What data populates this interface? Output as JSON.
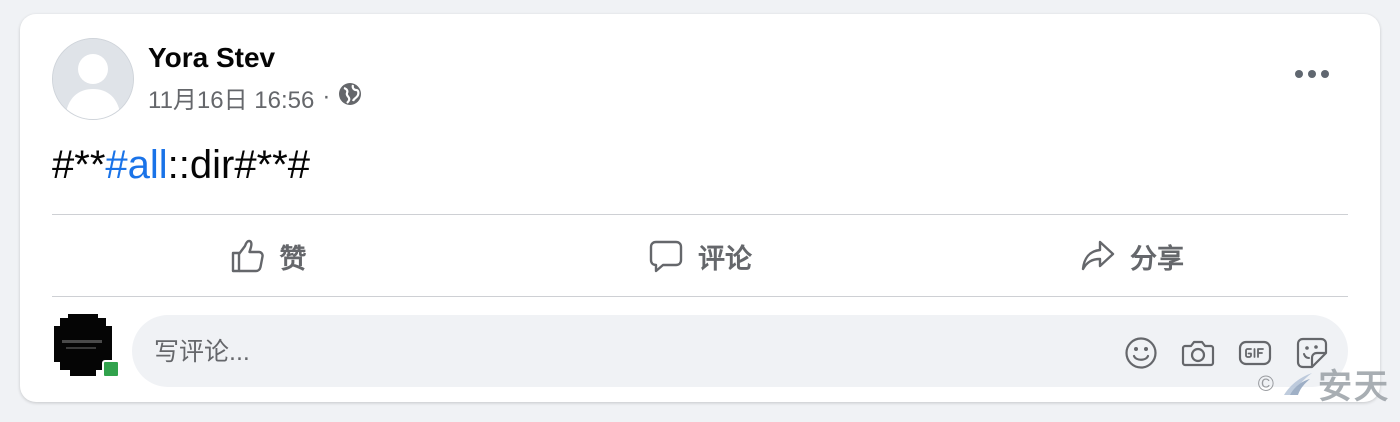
{
  "post": {
    "author_name": "Yora Stev",
    "timestamp": "11月16日 16:56",
    "separator": "·",
    "privacy_icon": "globe-icon",
    "more_icon": "more-horizontal-icon",
    "text": {
      "prefix": "#**",
      "hashtag": "#all",
      "suffix": "::dir#**#"
    }
  },
  "actions": {
    "like_label": "赞",
    "comment_label": "评论",
    "share_label": "分享"
  },
  "comment_box": {
    "placeholder": "写评论...",
    "tools": [
      "emoji-icon",
      "camera-icon",
      "gif-icon",
      "sticker-icon"
    ]
  },
  "watermark": {
    "symbol": "©",
    "brand": "安天"
  },
  "colors": {
    "hashtag": "#1a73e8",
    "secondary_text": "#65676b",
    "online": "#31a24c",
    "page_bg": "#f0f2f5"
  }
}
